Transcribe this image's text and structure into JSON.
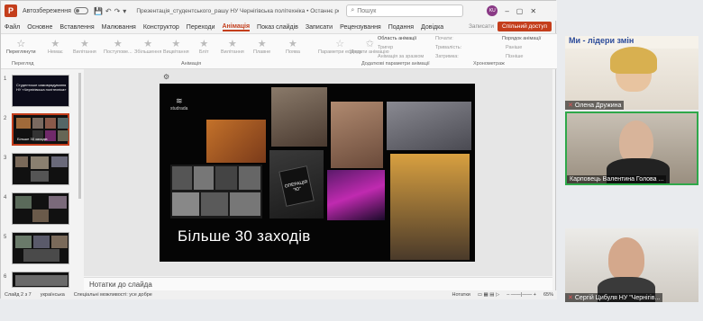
{
  "app": {
    "logo": "P",
    "autosave": "Автозбереження",
    "doc_title": "Презентація_студентського_рашу НУ Чернігівська політехніка • Останнє редагування: 1 год. тому",
    "search_placeholder": "Пошук",
    "avatar_initials": "KU"
  },
  "menu": {
    "tabs": [
      "Файл",
      "Основне",
      "Вставлення",
      "Малювання",
      "Конструктор",
      "Переходи",
      "Анімація",
      "Показ слайдів",
      "Записати",
      "Рецензування",
      "Подання",
      "Довідка"
    ],
    "active_tab": "Анімація",
    "record_label": "Записати",
    "share_label": "Спільний доступ"
  },
  "ribbon": {
    "preview_label": "Переглянути",
    "preview_group": "Перегляд",
    "animations": [
      "Немає",
      "Вилітання",
      "Поступове...",
      "Збільшення",
      "Вицвітання",
      "Бліт",
      "Вилітання",
      "Плавне",
      "Поява"
    ],
    "animation_group": "Анімація",
    "effect_options": "Параметри ефекту",
    "add_animation": "Додати анімацію",
    "area_label": "Область анімації",
    "trigger_label": "Тригер",
    "painter_label": "Анімація за зразком",
    "adv_group": "Додаткові параметри анімації",
    "start_label": "Почати:",
    "duration_label": "Тривалість:",
    "delay_label": "Затримка:",
    "timing_group": "Хронометраж",
    "reorder_label": "Порядок анімації",
    "earlier_label": "Раніше",
    "later_label": "Пізніше"
  },
  "thumbnails": [
    {
      "num": "1",
      "caption": "Студентське самоврядування НУ «Чернігівська політехніка»"
    },
    {
      "num": "2",
      "caption": "Більше 30 заходів"
    },
    {
      "num": "3",
      "caption": ""
    },
    {
      "num": "4",
      "caption": ""
    },
    {
      "num": "5",
      "caption": ""
    },
    {
      "num": "6",
      "caption": ""
    }
  ],
  "slide": {
    "caption": "Більше 30 заходів",
    "logo_text": "studrada",
    "book_text": "ОПЕРАЦІЯ \"Ю\""
  },
  "notes_placeholder": "Нотатки до слайда",
  "status": {
    "slide_info": "Слайд 2 з 7",
    "language": "українська",
    "accessibility": "Спеціальні можливості: усе добре",
    "notes_btn": "Нотатки",
    "zoom": "65%"
  },
  "participants": [
    {
      "name": "Олена Дружина",
      "muted": true
    },
    {
      "name": "Карповець Валентина Голова ...",
      "muted": false
    },
    {
      "name": "Сергій Цибуля НУ \"Чернігів...",
      "muted": true
    }
  ],
  "video_banner": "Ми - лідери змін"
}
